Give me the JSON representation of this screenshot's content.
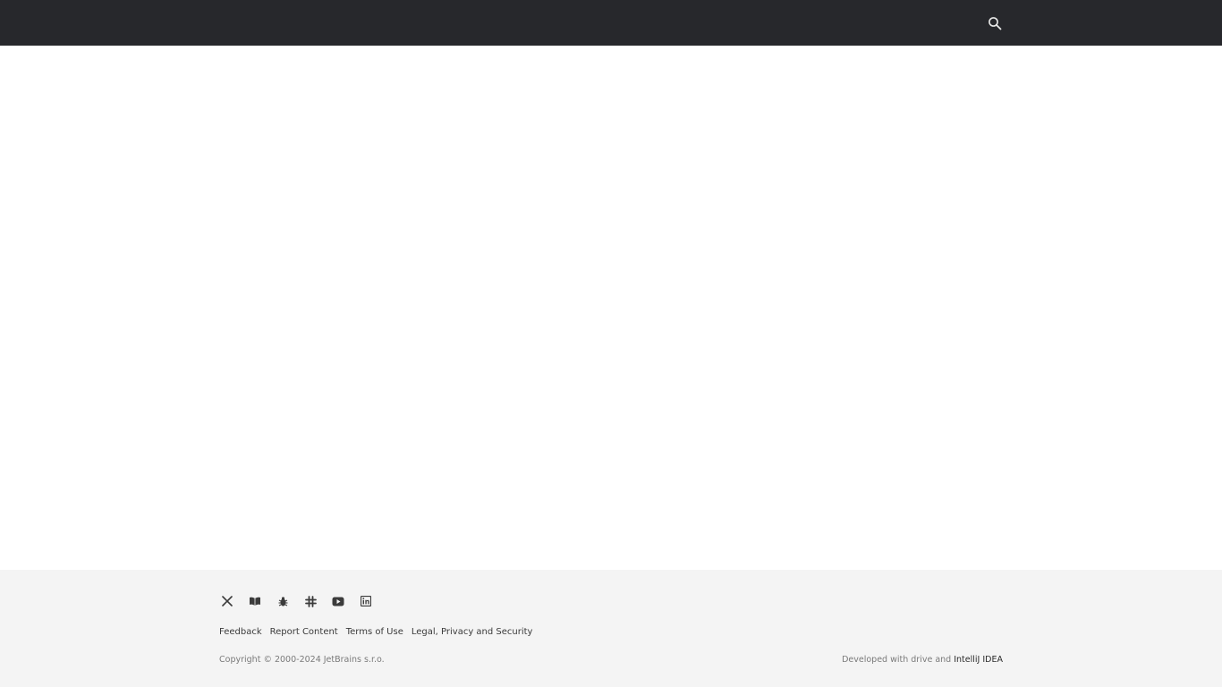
{
  "header": {
    "search_icon": "search-icon"
  },
  "footer": {
    "social": [
      {
        "name": "x-twitter-icon"
      },
      {
        "name": "blog-icon"
      },
      {
        "name": "bug-tracker-icon"
      },
      {
        "name": "slack-icon"
      },
      {
        "name": "youtube-icon"
      },
      {
        "name": "linkedin-icon"
      }
    ],
    "links": {
      "feedback": "Feedback",
      "report": "Report Content",
      "terms": "Terms of Use",
      "legal": "Legal, Privacy and Security"
    },
    "copyright": "Copyright © 2000-2024 JetBrains s.r.o.",
    "developed_prefix": "Developed with drive and ",
    "developed_link": "IntelliJ IDEA"
  },
  "colors": {
    "topbar": "#27282c",
    "footer_bg": "#f4f4f4"
  }
}
